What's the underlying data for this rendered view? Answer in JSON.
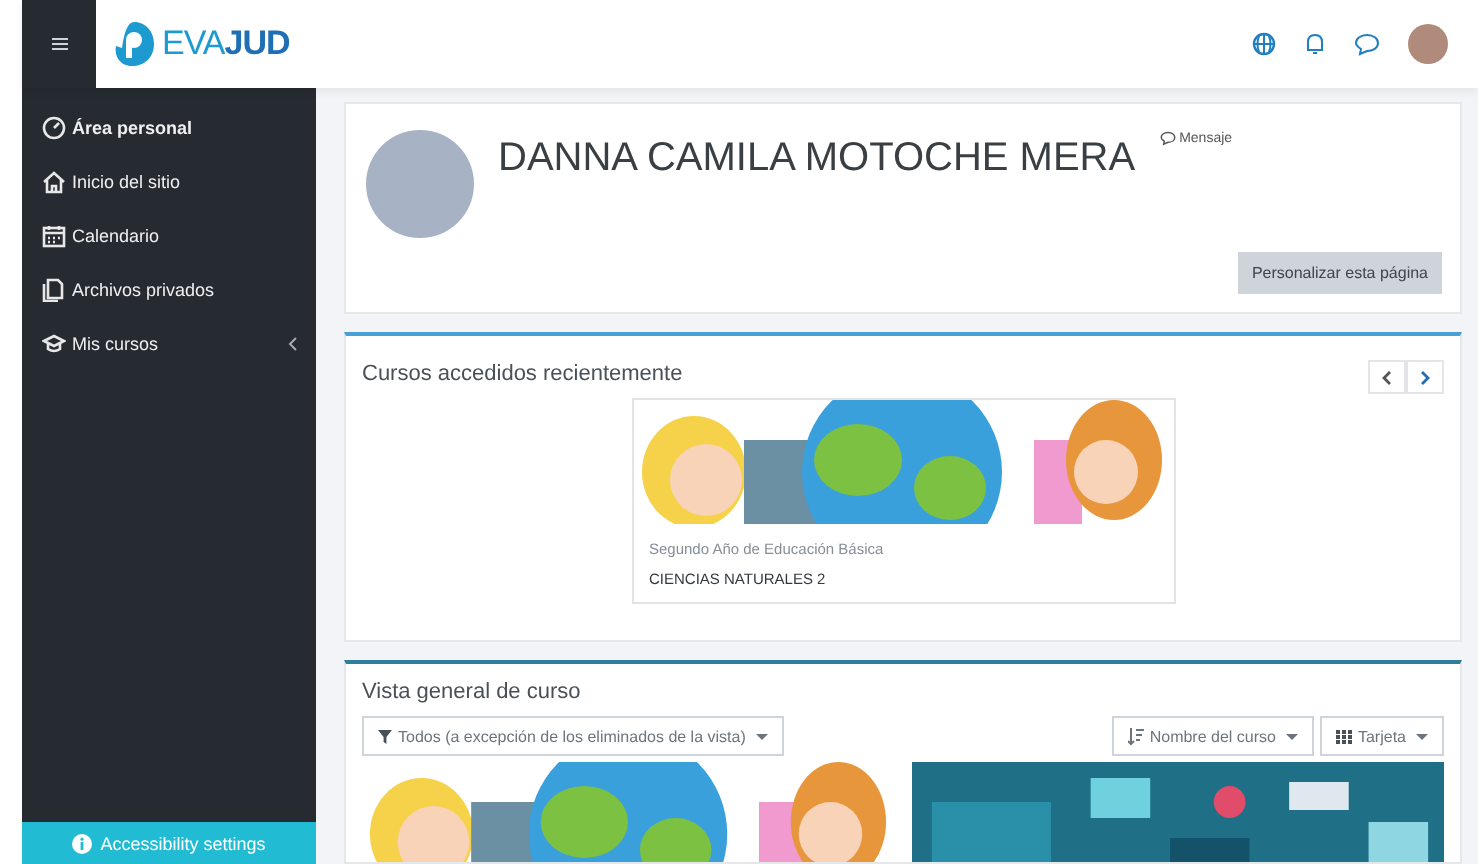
{
  "header": {
    "logo": "EVA**JUD**"
  },
  "sidebar": {
    "items": [
      {
        "label": "Área personal",
        "kind": "link",
        "selected": true
      },
      {
        "label": "Inicio del sitio",
        "kind": "link",
        "selected": false
      },
      {
        "label": "Calendario",
        "kind": "link",
        "selected": false
      },
      {
        "label": "Archivos privados",
        "kind": "link",
        "selected": false
      },
      {
        "label": "Mis cursos",
        "kind": "group",
        "selected": false
      }
    ],
    "footer": "Accessibility settings"
  },
  "profile": {
    "name": "DANNA CAMILA MOTOCHE MERA",
    "message_link": "Mensaje",
    "customize_button": "Personalizar esta página"
  },
  "recent": {
    "title": "Cursos accedidos recientemente",
    "courses": [
      {
        "category": "Segundo Año de Educación Básica",
        "name": "CIENCIAS NATURALES 2"
      }
    ]
  },
  "overview": {
    "title": "Vista general de curso",
    "filter": "Todos (a excepción de los eliminados de la vista)",
    "sort": "Nombre del curso",
    "view": "Tarjeta"
  }
}
